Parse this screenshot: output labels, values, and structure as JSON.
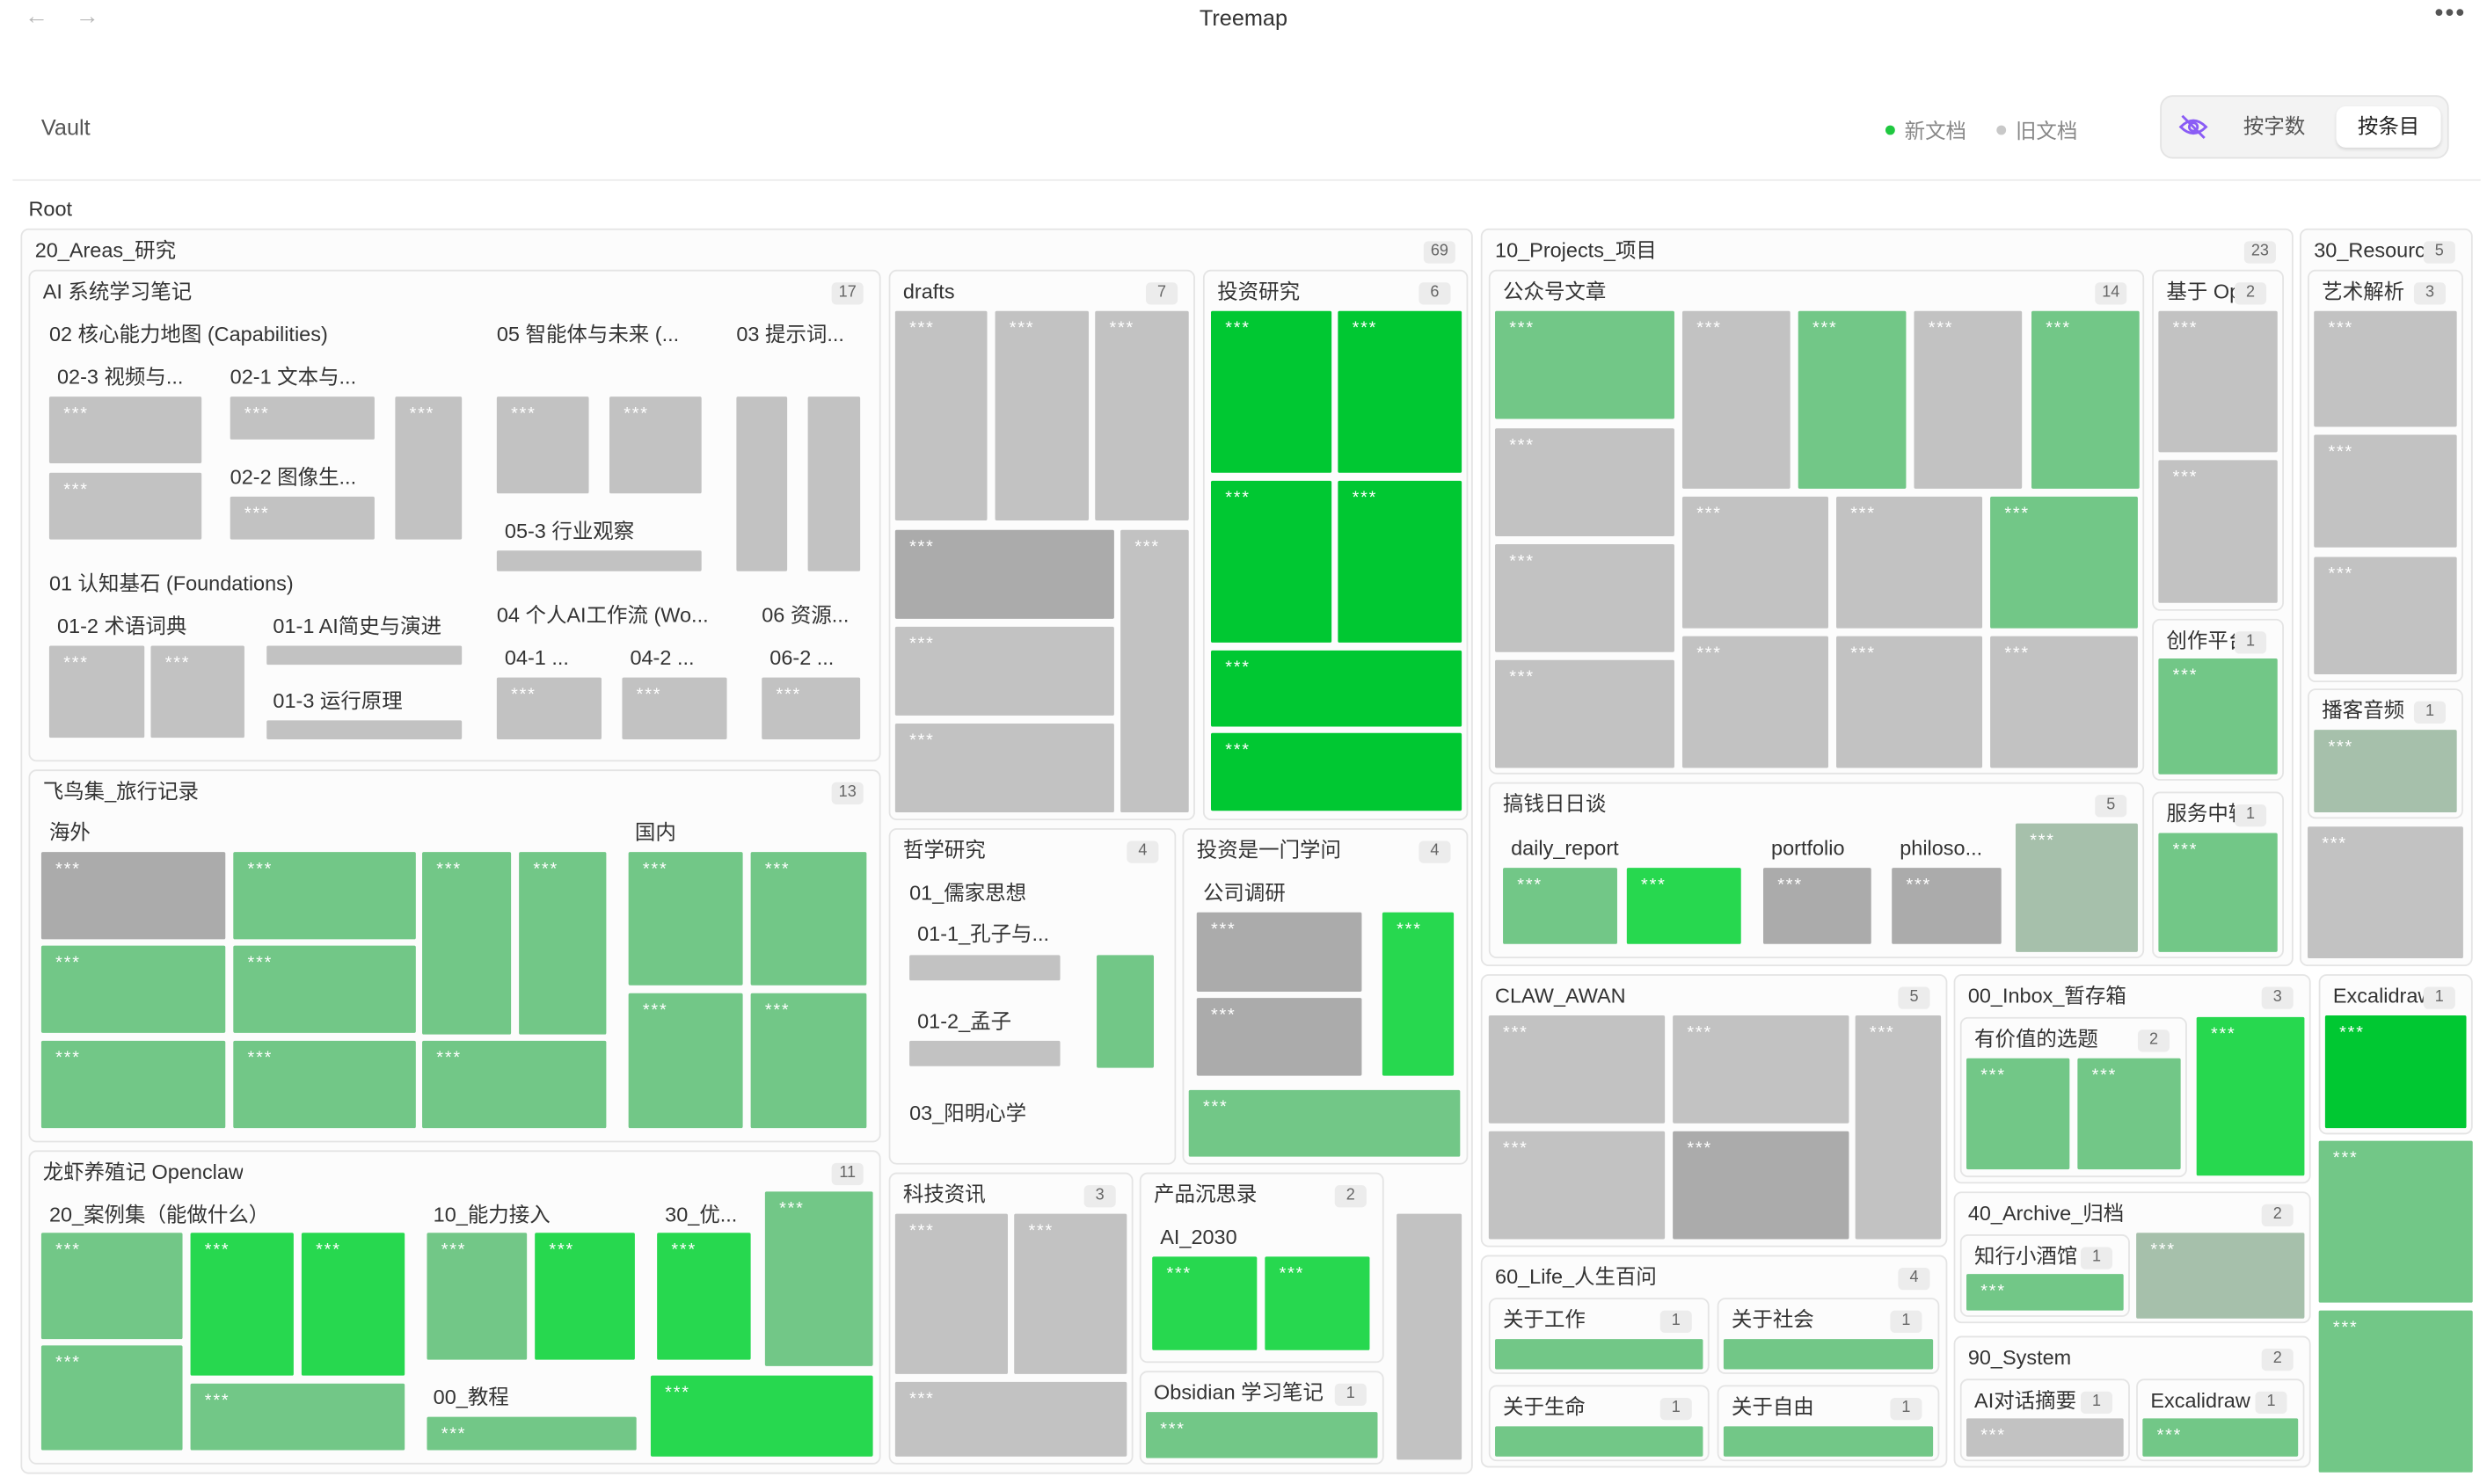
{
  "app": {
    "title": "Treemap",
    "vault": "Vault",
    "root": "Root",
    "more": "•••",
    "nav_back": "←",
    "nav_forward": "→"
  },
  "legend": {
    "new_doc": "新文档",
    "old_doc": "旧文档",
    "new_color": "#1fc840",
    "old_color": "#c8c8c8"
  },
  "toggle": {
    "by_chars": "按字数",
    "by_entries": "按条目",
    "hide_icon": "eye-off-icon"
  },
  "colors": {
    "gray": "#c2c2c2",
    "gray_dark": "#ababab",
    "gray_sage": "#a6c0ab",
    "green_light": "#72c787",
    "green_mid": "#27d84f",
    "green_bright": "#00c832"
  },
  "masked": "***",
  "groups": {
    "areas": {
      "label": "20_Areas_研究",
      "count": "69"
    },
    "ai_notes": {
      "label": "AI 系统学习笔记",
      "count": "17"
    },
    "cap_map": "02 核心能力地图 (Capabilities)",
    "video": "02-3 视频与...",
    "text": "02-1 文本与...",
    "image": "02-2 图像生...",
    "agents": "05 智能体与未来 (...",
    "prompt": "03 提示词...",
    "industry": "05-3 行业观察",
    "foundations": "01 认知基石 (Foundations)",
    "glossary": "01-2 术语词典",
    "history": "01-1 AI简史与演进",
    "principle": "01-3 运行原理",
    "workflow": "04 个人AI工作流 (Wo...",
    "wf1": "04-1 ...",
    "wf2": "04-2 ...",
    "resources_sub": "06 资源...",
    "res2": "06-2 ...",
    "travel": {
      "label": "飞鸟集_旅行记录",
      "count": "13"
    },
    "abroad": "海外",
    "domestic": "国内",
    "openclaw": {
      "label": "龙虾养殖记 Openclaw",
      "count": "11"
    },
    "cases": "20_案例集（能做什么）",
    "access": "10_能力接入",
    "optim": "30_优...",
    "tutorial": "00_教程",
    "drafts": {
      "label": "drafts",
      "count": "7"
    },
    "invest": {
      "label": "投资研究",
      "count": "6"
    },
    "philo": {
      "label": "哲学研究",
      "count": "4"
    },
    "confucian": "01_儒家思想",
    "kongzi": "01-1_孔子与...",
    "mengzi": "01-2_孟子",
    "yangming": "03_阳明心学",
    "invest_learn": {
      "label": "投资是一门学问",
      "count": "4"
    },
    "company": "公司调研",
    "tech": {
      "label": "科技资讯",
      "count": "3"
    },
    "product": {
      "label": "产品沉思录",
      "count": "2"
    },
    "ai2030": "AI_2030",
    "obsidian": {
      "label": "Obsidian 学习笔记",
      "count": "1"
    },
    "projects": {
      "label": "10_Projects_项目",
      "count": "23"
    },
    "wechat": {
      "label": "公众号文章",
      "count": "14"
    },
    "basedon": {
      "label": "基于 Op...",
      "count": "2"
    },
    "creator": {
      "label": "创作平台...",
      "count": "1"
    },
    "money": {
      "label": "搞钱日日谈",
      "count": "5"
    },
    "daily": "daily_report",
    "portfolio": "portfolio",
    "philoso": "philoso...",
    "service": {
      "label": "服务中转...",
      "count": "1"
    },
    "resources": {
      "label": "30_Resourc...",
      "count": "5"
    },
    "art": {
      "label": "艺术解析",
      "count": "3"
    },
    "podcast": {
      "label": "播客音频",
      "count": "1"
    },
    "claw": {
      "label": "CLAW_AWAN",
      "count": "5"
    },
    "inbox": {
      "label": "00_Inbox_暂存箱",
      "count": "3"
    },
    "valuable": {
      "label": "有价值的选题",
      "count": "2"
    },
    "life": {
      "label": "60_Life_人生百问",
      "count": "4"
    },
    "work": {
      "label": "关于工作",
      "count": "1"
    },
    "society": {
      "label": "关于社会",
      "count": "1"
    },
    "lifeq": {
      "label": "关于生命",
      "count": "1"
    },
    "freedom": {
      "label": "关于自由",
      "count": "1"
    },
    "archive": {
      "label": "40_Archive_归档",
      "count": "2"
    },
    "tavern": {
      "label": "知行小酒馆",
      "count": "1"
    },
    "system": {
      "label": "90_System",
      "count": "2"
    },
    "aichat": {
      "label": "AI对话摘要",
      "count": "1"
    },
    "excal_sys": {
      "label": "Excalidraw",
      "count": "1"
    },
    "excal_top": {
      "label": "Excalidraw",
      "count": "1"
    }
  }
}
